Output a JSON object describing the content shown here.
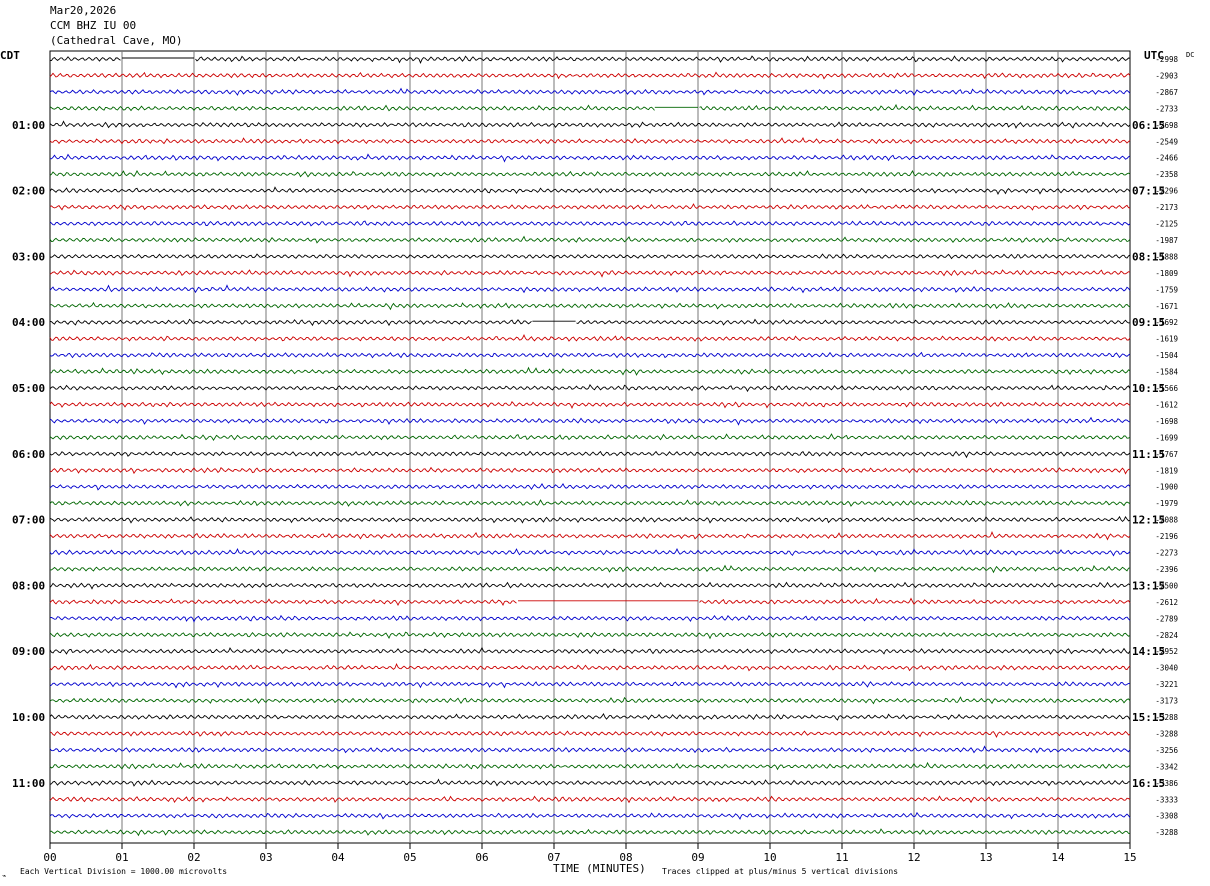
{
  "header": {
    "date": "Mar20,2026",
    "station": "CCM BHZ IU 00",
    "location": "(Cathedral Cave, MO)"
  },
  "chart_data": {
    "type": "line",
    "title": "",
    "left_axis_label": "CDT",
    "right_axis_label": "UTC",
    "dc_label": "DC",
    "xlabel": "TIME (MINUTES)",
    "xlim": [
      0,
      15
    ],
    "x_ticks": [
      "00",
      "01",
      "02",
      "03",
      "04",
      "05",
      "06",
      "07",
      "08",
      "09",
      "10",
      "11",
      "12",
      "13",
      "14",
      "15"
    ],
    "left_time_labels": [
      "01:00",
      "02:00",
      "03:00",
      "04:00",
      "05:00",
      "06:00",
      "07:00",
      "08:00",
      "09:00",
      "10:00",
      "11:00"
    ],
    "right_time_labels": [
      "06:15",
      "07:15",
      "08:15",
      "09:15",
      "10:15",
      "11:15",
      "12:15",
      "13:15",
      "14:15",
      "15:15",
      "16:15"
    ],
    "trace_colors": [
      "#000000",
      "#cc0000",
      "#0000cc",
      "#006600"
    ],
    "dc_values": [
      "-2998",
      "-2903",
      "-2867",
      "-2733",
      "-2698",
      "-2549",
      "-2466",
      "-2358",
      "-2296",
      "-2173",
      "-2125",
      "-1987",
      "-1888",
      "-1809",
      "-1759",
      "-1671",
      "-1692",
      "-1619",
      "-1504",
      "-1584",
      "-1566",
      "-1612",
      "-1698",
      "-1699",
      "-1767",
      "-1819",
      "-1900",
      "-1979",
      "-2088",
      "-2196",
      "-2273",
      "-2396",
      "-2500",
      "-2612",
      "-2789",
      "-2824",
      "-2952",
      "-3040",
      "-3221",
      "-3173",
      "-3288",
      "-3288",
      "-3256",
      "-3342",
      "-3386",
      "-3333",
      "-3308",
      "-3288"
    ],
    "gaps": [
      {
        "row": 0,
        "from_min": 1.0,
        "to_min": 2.0
      },
      {
        "row": 3,
        "from_min": 8.4,
        "to_min": 9.0
      },
      {
        "row": 16,
        "from_min": 6.7,
        "to_min": 7.3
      },
      {
        "row": 33,
        "from_min": 6.5,
        "to_min": 9.0
      }
    ]
  },
  "footer": {
    "left": "Each Vertical Division = 1000.00 microvolts",
    "right": "Traces clipped at plus/minus 5 vertical divisions",
    "corner_mark": "⌁"
  }
}
